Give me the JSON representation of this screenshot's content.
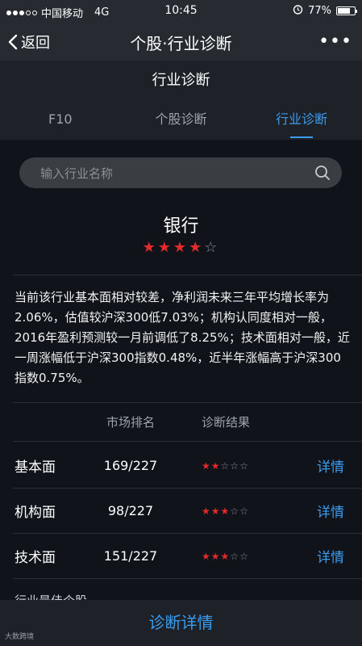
{
  "status_bar": {
    "carrier": "中国移动",
    "network": "4G",
    "time": "10:45",
    "battery": "77%",
    "battery_level": 0.77
  },
  "nav": {
    "back_label": "返回",
    "title": "个股·行业诊断",
    "more": "•••"
  },
  "sub_header": {
    "title": "行业诊断"
  },
  "tabs": [
    {
      "label": "F10",
      "active": false
    },
    {
      "label": "个股诊断",
      "active": false
    },
    {
      "label": "行业诊断",
      "active": true
    }
  ],
  "search": {
    "placeholder": "输入行业名称"
  },
  "industry": {
    "name": "银行",
    "rating": 4,
    "rating_max": 5
  },
  "summary": "当前该行业基本面相对较差，净利润未来三年平均增长率为2.06%，估值较沪深300低7.03%；机构认同度相对一般，2016年盈利预测较一月前调低了8.25%；技术面相对一般，近一周涨幅低于沪深300指数0.48%，近半年涨幅高于沪深300指数0.75%。",
  "table": {
    "headers": {
      "rank": "市场排名",
      "result": "诊断结果"
    },
    "rows": [
      {
        "label": "基本面",
        "rank": "169/227",
        "stars": 2,
        "link": "详情"
      },
      {
        "label": "机构面",
        "rank": "98/227",
        "stars": 3,
        "link": "详情"
      },
      {
        "label": "技术面",
        "rank": "151/227",
        "stars": 3,
        "link": "详情"
      }
    ]
  },
  "partial_section": "行业最佳个股",
  "bottom_button": "诊断详情",
  "watermark": "大数跨境",
  "colors": {
    "accent": "#3a9cf0",
    "star": "#e32b2b",
    "background": "#101319"
  }
}
